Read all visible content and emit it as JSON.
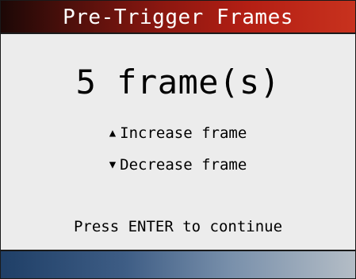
{
  "header": {
    "title": "Pre-Trigger Frames"
  },
  "main": {
    "value_label": "5 frame(s)",
    "options": [
      {
        "icon": "triangle-up-icon",
        "glyph": "▲",
        "label": "Increase frame"
      },
      {
        "icon": "triangle-down-icon",
        "glyph": "▼",
        "label": "Decrease frame"
      }
    ],
    "hint": "Press ENTER to continue"
  },
  "colors": {
    "title_bar_gradient": [
      "#1c0806",
      "#8a1710",
      "#c8321e"
    ],
    "footer_bar_gradient": [
      "#1f3f67",
      "#7990ab",
      "#b4bdc6"
    ],
    "background": "#ececec",
    "text": "#000000",
    "title_text": "#ffffff"
  }
}
